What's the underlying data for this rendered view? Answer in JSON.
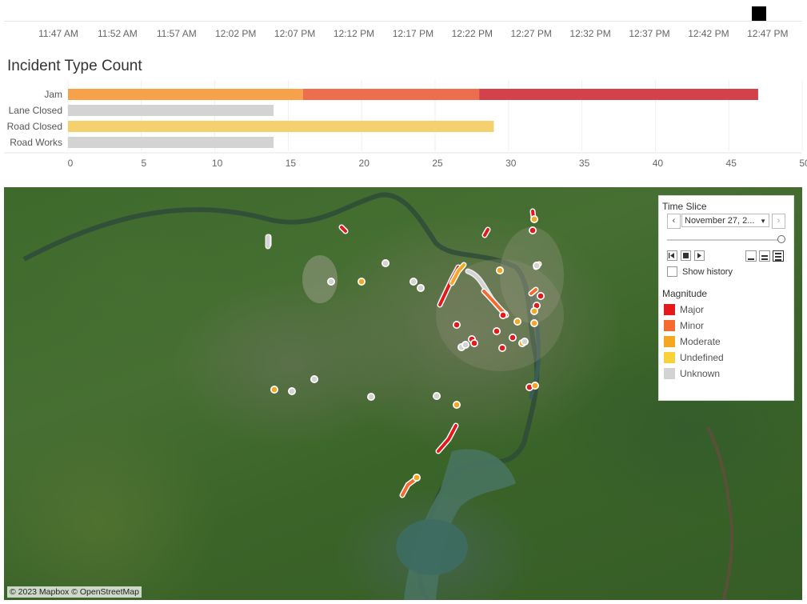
{
  "timeline": {
    "ticks": [
      "11:47 AM",
      "11:52 AM",
      "11:57 AM",
      "12:02 PM",
      "12:07 PM",
      "12:12 PM",
      "12:17 PM",
      "12:22 PM",
      "12:27 PM",
      "12:32 PM",
      "12:37 PM",
      "12:42 PM",
      "12:47 PM"
    ]
  },
  "chart_data": {
    "type": "bar",
    "orientation": "horizontal",
    "stacked": true,
    "title": "Incident Type Count",
    "categories": [
      "Jam",
      "Lane Closed",
      "Road Closed",
      "Road Works"
    ],
    "segments": [
      [
        {
          "magnitude": "Moderate",
          "value": 16,
          "color": "#f7a14b"
        },
        {
          "magnitude": "Minor",
          "value": 12,
          "color": "#ec6e4c"
        },
        {
          "magnitude": "Major",
          "value": 19,
          "color": "#d3424b"
        }
      ],
      [
        {
          "magnitude": "Unknown",
          "value": 14,
          "color": "#d3d3d3"
        }
      ],
      [
        {
          "magnitude": "Undefined",
          "value": 29,
          "color": "#f4d06f"
        }
      ],
      [
        {
          "magnitude": "Unknown",
          "value": 14,
          "color": "#d3d3d3"
        }
      ]
    ],
    "xticks": [
      0,
      5,
      10,
      15,
      20,
      25,
      30,
      35,
      40,
      45,
      50
    ],
    "xlim": [
      0,
      50
    ],
    "grid": true
  },
  "legend_panel": {
    "time_slice_title": "Time Slice",
    "time_slice_value": "November 27, 2...",
    "show_history_label": "Show history",
    "magnitude_title": "Magnitude",
    "items": [
      {
        "label": "Major",
        "color": "#e31a1c"
      },
      {
        "label": "Minor",
        "color": "#f46a30"
      },
      {
        "label": "Moderate",
        "color": "#f5a623"
      },
      {
        "label": "Undefined",
        "color": "#f7d23a"
      },
      {
        "label": "Unknown",
        "color": "#d3d3d3"
      }
    ]
  },
  "map": {
    "attribution": "© 2023 Mapbox © OpenStreetMap"
  }
}
